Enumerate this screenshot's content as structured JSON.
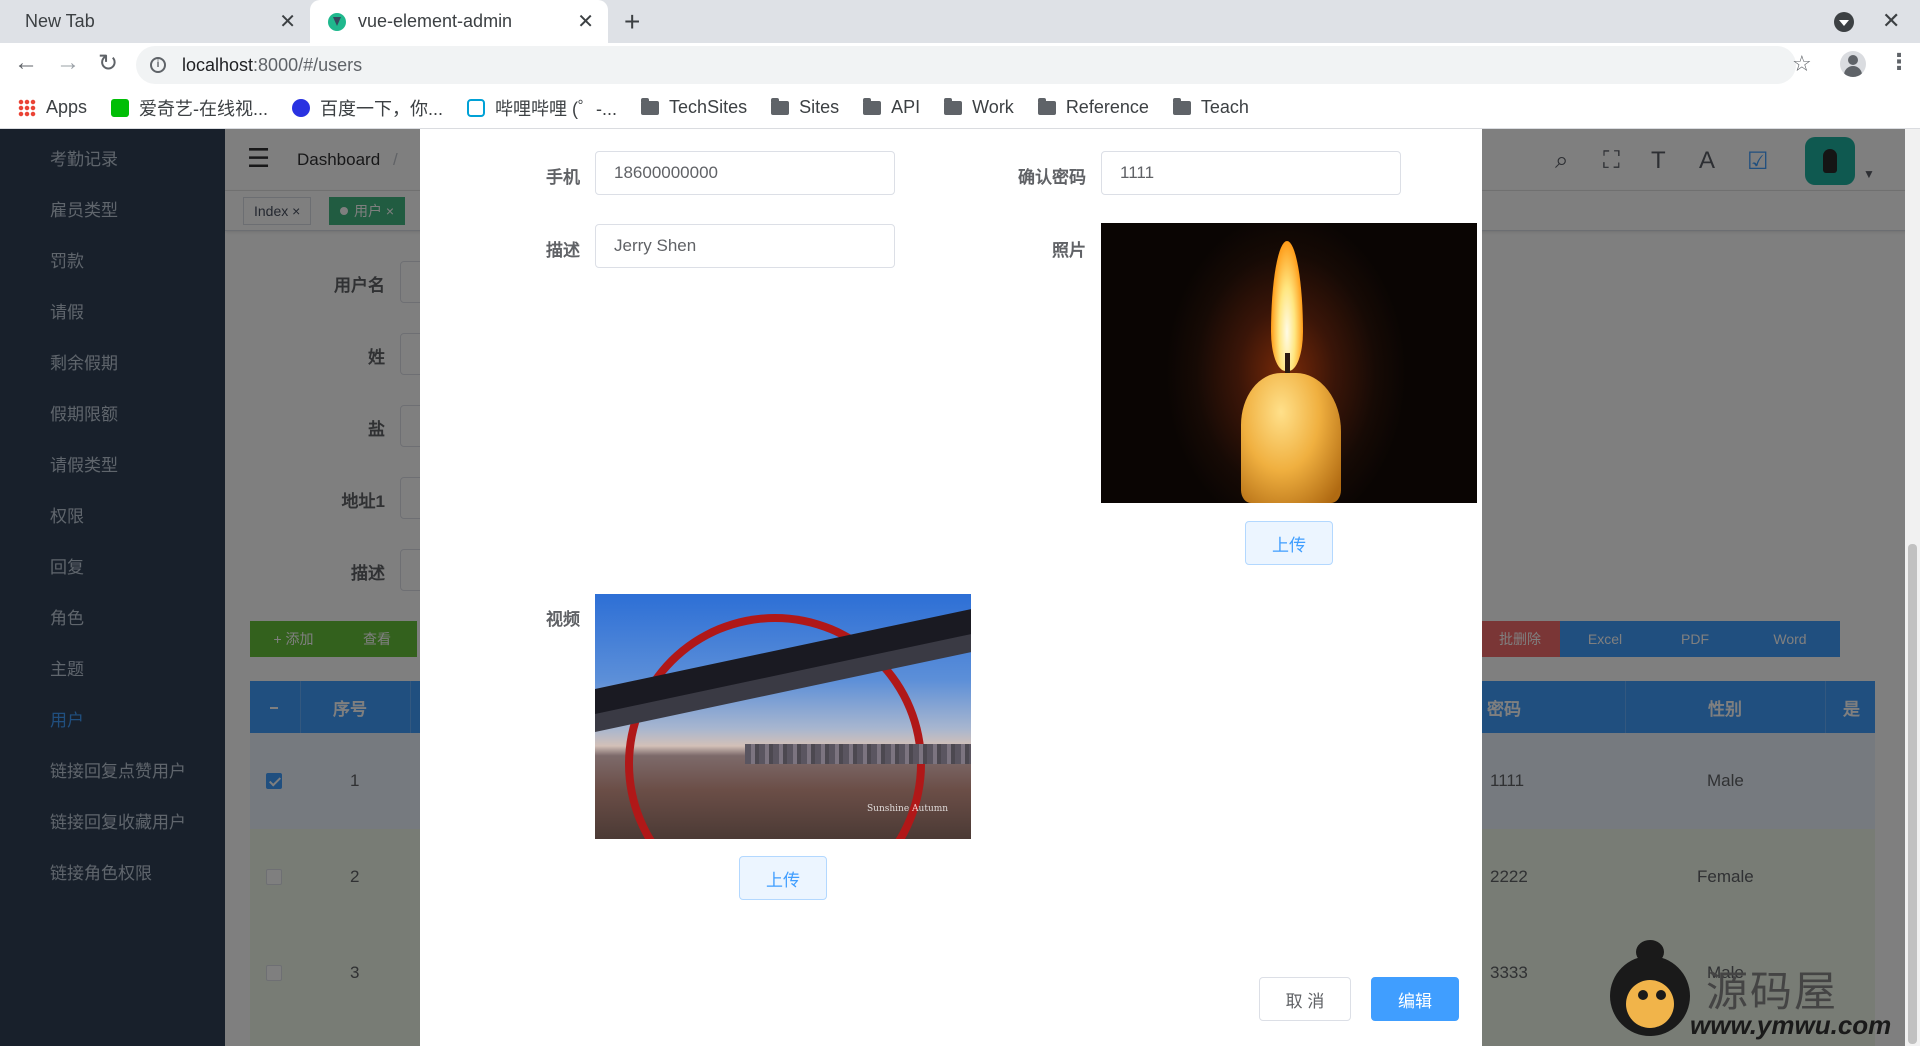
{
  "browser": {
    "tabs": [
      {
        "title": "New Tab",
        "active": false
      },
      {
        "title": "vue-element-admin",
        "active": true
      }
    ],
    "close_glyph": "✕",
    "new_tab_glyph": "+",
    "url_host": "localhost",
    "url_path": ":8000/#/users",
    "bookmarks": [
      "Apps",
      "爱奇艺-在线视...",
      "百度一下，你...",
      "哔哩哔哩 (゜-...",
      "TechSites",
      "Sites",
      "API",
      "Work",
      "Reference",
      "Teach"
    ]
  },
  "sidebar": {
    "items": [
      "考勤记录",
      "雇员类型",
      "罚款",
      "请假",
      "剩余假期",
      "假期限额",
      "请假类型",
      "权限",
      "回复",
      "角色",
      "主题",
      "用户",
      "链接回复点赞用户",
      "链接回复收藏用户",
      "链接角色权限"
    ],
    "active": "用户",
    "active_color": "#409eff"
  },
  "navbar": {
    "breadcrumb_home": "Dashboard",
    "breadcrumb_sep": "/"
  },
  "tags": {
    "index": "Index",
    "users": "用户",
    "close": "×"
  },
  "filter_form": {
    "labels": [
      "用户名",
      "姓",
      "盐",
      "地址1",
      "描述"
    ]
  },
  "actions": {
    "add": "+ 添加",
    "view": "查看",
    "delete": "批删除",
    "excel": "Excel",
    "pdf": "PDF",
    "word": "Word"
  },
  "table": {
    "headers": {
      "index": "序号",
      "password": "密码",
      "gender": "性别",
      "more": "是"
    },
    "rows": [
      {
        "index": "1",
        "password": "1111",
        "gender": "Male",
        "checked": true
      },
      {
        "index": "2",
        "password": "2222",
        "gender": "Female",
        "checked": false
      },
      {
        "index": "3",
        "password": "3333",
        "gender": "Male",
        "checked": false
      }
    ]
  },
  "dialog": {
    "phone_label": "手机",
    "phone_value": "18600000000",
    "confirm_password_label": "确认密码",
    "confirm_password_value": "1111",
    "description_label": "描述",
    "description_value": "Jerry Shen",
    "photo_label": "照片",
    "video_label": "视频",
    "upload_label": "上传",
    "cancel_label": "取 消",
    "edit_label": "编辑",
    "video_caption": "Sunshine Autumn"
  },
  "watermark": {
    "site_name": "源码屋",
    "site_url": "www.ymwu.com"
  },
  "colors": {
    "primary": "#409eff",
    "success": "#67c23a",
    "danger": "#f56c6c",
    "sidebar_bg": "#304156",
    "tag_active": "#42b983"
  }
}
